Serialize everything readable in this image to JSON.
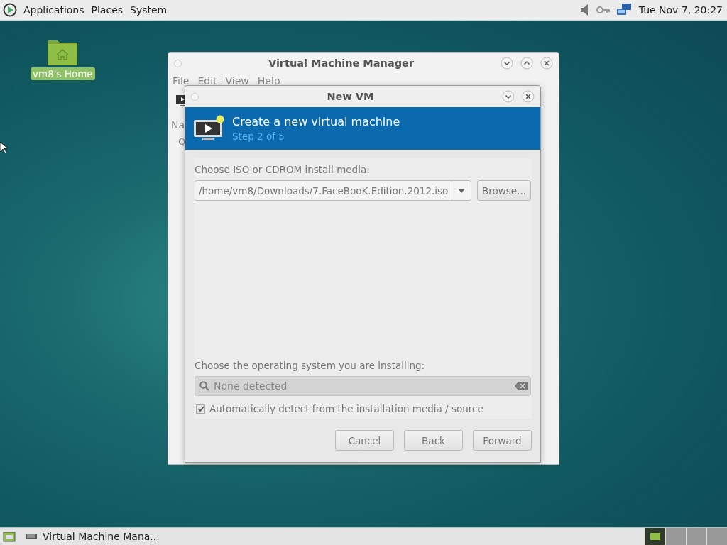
{
  "top_panel": {
    "menus": [
      "Applications",
      "Places",
      "System"
    ],
    "clock": "Tue Nov 7, 20:27"
  },
  "desktop_icons": [
    {
      "label": "vm8's Home",
      "selected": true
    }
  ],
  "main_window": {
    "title": "Virtual Machine Manager",
    "menu": [
      "File",
      "Edit",
      "View",
      "Help"
    ],
    "column_header": "Na",
    "row_text": "Q"
  },
  "dialog": {
    "title": "New VM",
    "header": {
      "title": "Create a new virtual machine",
      "subtitle": "Step 2 of 5"
    },
    "media_label": "Choose ISO or CDROM install media:",
    "media_path": "/home/vm8/Downloads/7.FaceBooK.Edition.2012.iso",
    "browse": "Browse...",
    "os_label": "Choose the operating system you are installing:",
    "os_search": {
      "placeholder": "None detected"
    },
    "auto_detect": {
      "label": "Automatically detect from the installation media / source",
      "checked": true
    },
    "buttons": [
      "Cancel",
      "Back",
      "Forward"
    ]
  },
  "taskbar": {
    "tasks": [
      {
        "label": "Virtual Machine Mana...",
        "selected": false
      }
    ],
    "workspaces": [
      {
        "selected": true
      },
      {
        "selected": false
      },
      {
        "selected": false
      },
      {
        "selected": false
      }
    ]
  }
}
